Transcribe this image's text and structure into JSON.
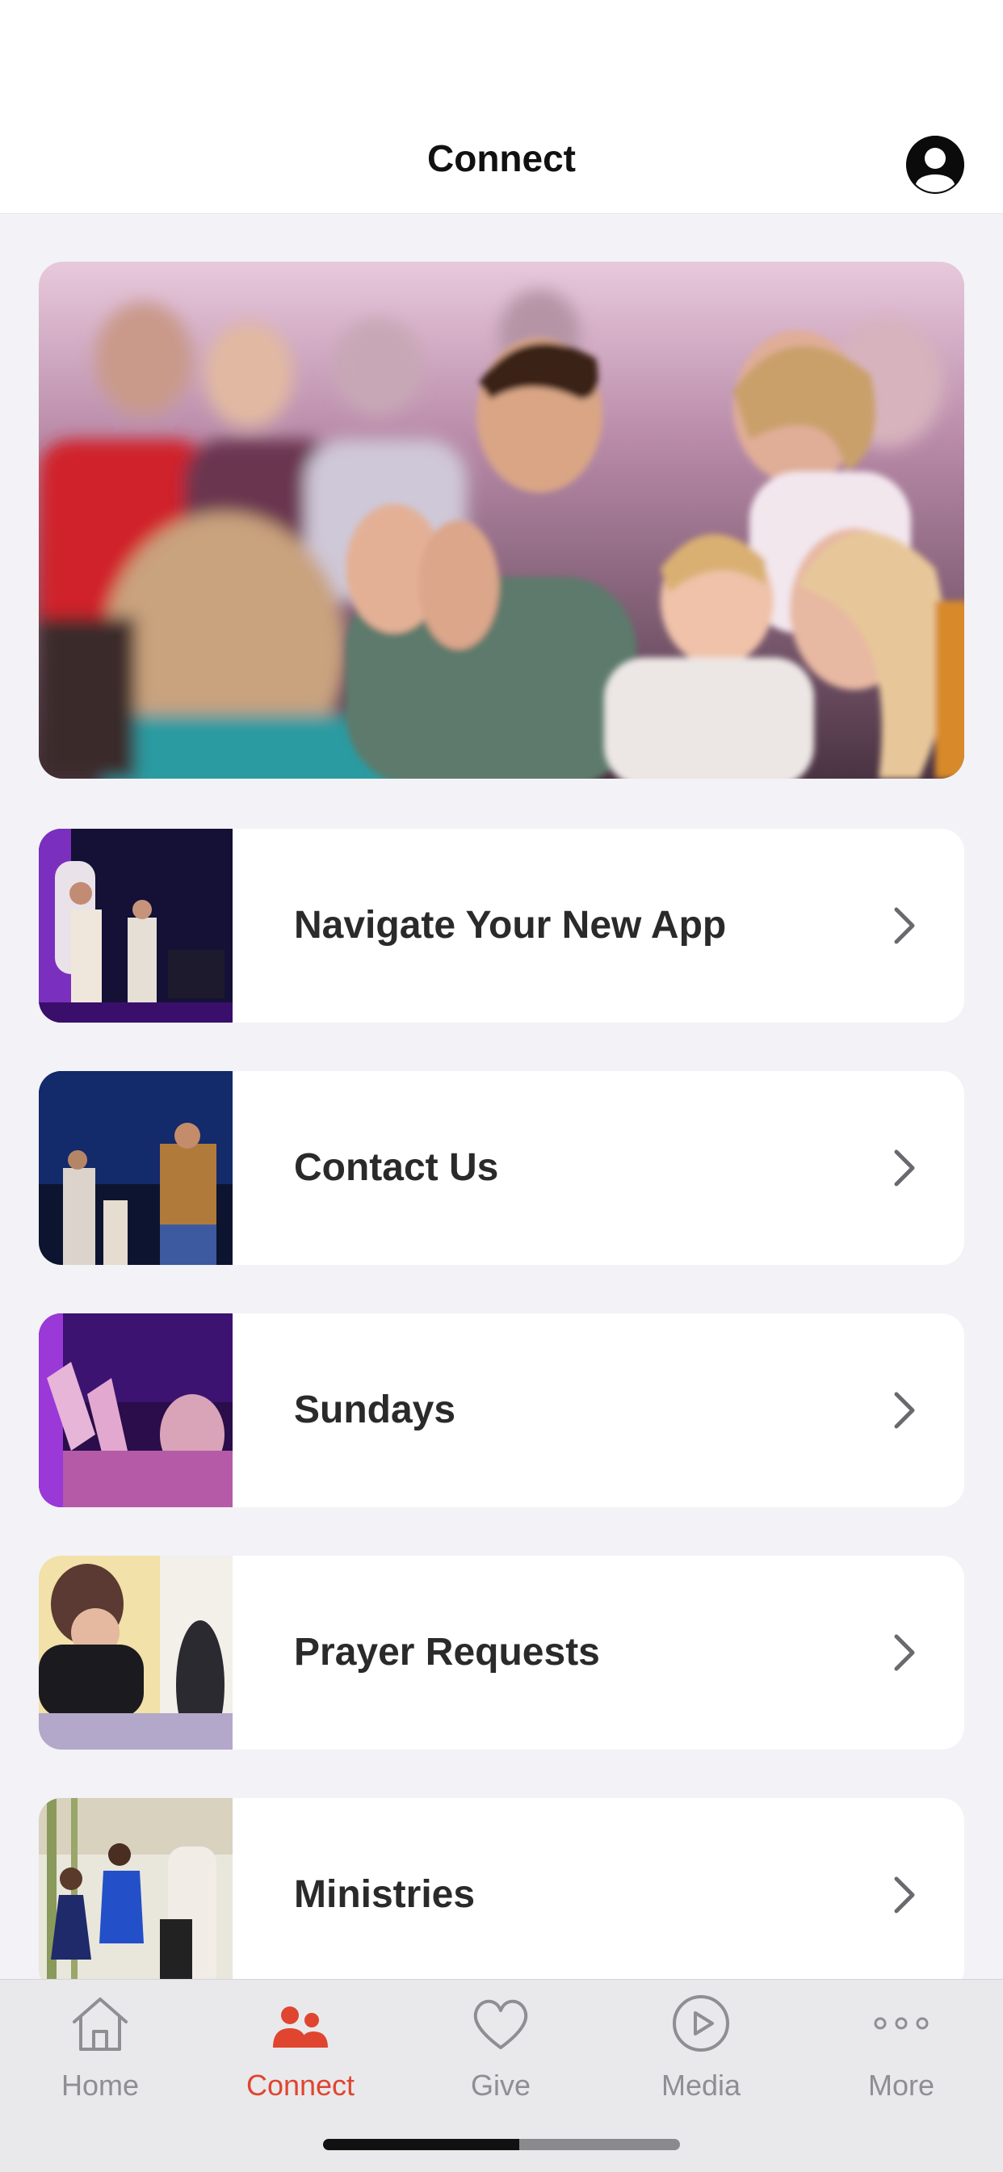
{
  "header": {
    "title": "Connect"
  },
  "hero": {
    "image": "worship-crowd-clapping-photo"
  },
  "list": {
    "items": [
      {
        "label": "Navigate Your New App",
        "thumb": "band-on-stage-photo"
      },
      {
        "label": "Contact Us",
        "thumb": "guitarist-on-stage-photo"
      },
      {
        "label": "Sundays",
        "thumb": "raised-hands-photo"
      },
      {
        "label": "Prayer Requests",
        "thumb": "prayer-photo"
      },
      {
        "label": "Ministries",
        "thumb": "kids-dancing-photo"
      }
    ]
  },
  "tabs": [
    {
      "label": "Home",
      "icon": "home-icon"
    },
    {
      "label": "Connect",
      "icon": "people-icon",
      "active": true
    },
    {
      "label": "Give",
      "icon": "heart-icon"
    },
    {
      "label": "Media",
      "icon": "play-circle-icon"
    },
    {
      "label": "More",
      "icon": "ellipsis-icon"
    }
  ],
  "colors": {
    "accent": "#e0452f",
    "inactive": "#8e8e93",
    "background": "#f2f2f7"
  }
}
